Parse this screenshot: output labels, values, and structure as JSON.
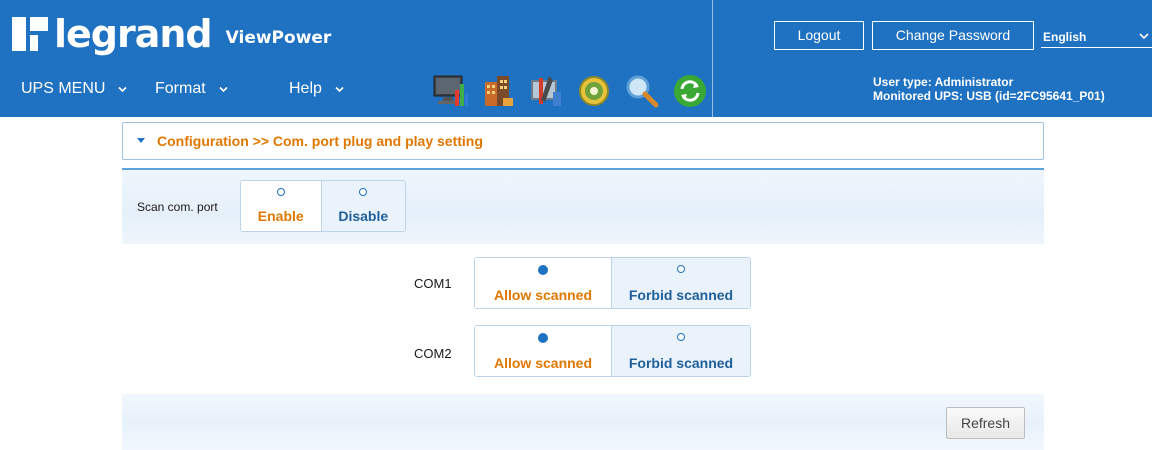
{
  "header": {
    "brand": "legrand",
    "product": "ViewPower",
    "logout_label": "Logout",
    "change_password_label": "Change Password",
    "language": "English",
    "user_type": "User type: Administrator",
    "monitored_ups": "Monitored UPS: USB (id=2FC95641_P01)",
    "background_color": "#1f71c1"
  },
  "nav": {
    "ups_menu": "UPS MENU",
    "format": "Format",
    "help": "Help"
  },
  "toolbar_icons": [
    "monitor-chart-icon",
    "buildings-icon",
    "tools-icon",
    "gear-icon",
    "magnifier-icon",
    "refresh-cycle-icon"
  ],
  "breadcrumb": "Configuration >> Com. port plug and play setting",
  "scan": {
    "label": "Scan com. port",
    "options": [
      "Enable",
      "Disable"
    ],
    "selected": "Enable"
  },
  "com_ports": [
    {
      "name": "COM1",
      "options": [
        "Allow scanned",
        "Forbid scanned"
      ],
      "selected": "Allow scanned"
    },
    {
      "name": "COM2",
      "options": [
        "Allow scanned",
        "Forbid scanned"
      ],
      "selected": "Allow scanned"
    }
  ],
  "refresh_label": "Refresh",
  "colors": {
    "accent_orange": "#e07700",
    "accent_blue": "#1f71c1"
  }
}
